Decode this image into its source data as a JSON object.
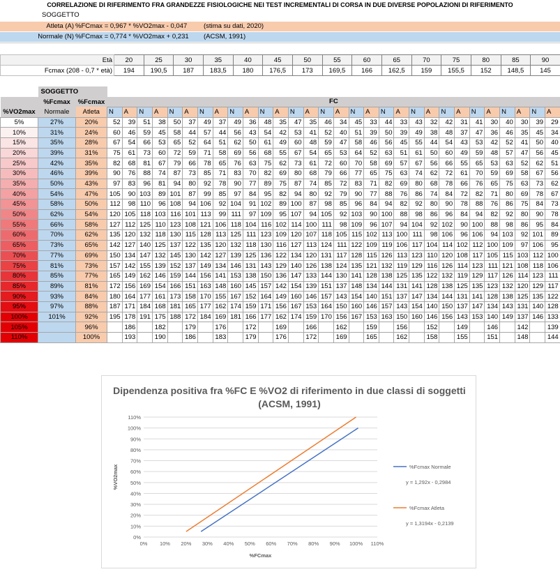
{
  "header": {
    "title": "CORRELAZIONE DI RIFERIMENTO FRA GRANDEZZE FISIOLOGICHE NEI TEST INCREMENTALI DI CORSA IN DUE DIVERSE POPOLAZIONI DI RIFERIMENTO",
    "soggetto": "SOGGETTO",
    "atleta": {
      "label": "Atleta (A)",
      "equation": "%FCmax = 0,967 * %VO2max - 0,047",
      "note": "(stima su dati, 2020)"
    },
    "normale": {
      "label": "Normale (N)",
      "equation": "%FCmax = 0,774 * %VO2max + 0,231",
      "note": "(ACSM, 1991)"
    }
  },
  "age_table": {
    "eta_label": "Età",
    "fcmax_label": "Fcmax (208 - 0,7 * età)",
    "eta": [
      "20",
      "25",
      "30",
      "35",
      "40",
      "45",
      "50",
      "55",
      "60",
      "65",
      "70",
      "75",
      "80",
      "85",
      "90"
    ],
    "fcmax": [
      "194",
      "190,5",
      "187",
      "183,5",
      "180",
      "176,5",
      "173",
      "169,5",
      "166",
      "162,5",
      "159",
      "155,5",
      "152",
      "148,5",
      "145"
    ]
  },
  "main_table": {
    "soggetto_label": "SOGGETTO",
    "fc_label": "FC",
    "vo2_header": "%VO2max",
    "fcmax_header": "%Fcmax",
    "normale_header": "Normale",
    "atleta_header": "Atleta",
    "n_label": "N",
    "a_label": "A",
    "rows": [
      {
        "vo2": "5%",
        "n": "27%",
        "a": "20%",
        "v": [
          "52",
          "39",
          "51",
          "38",
          "50",
          "37",
          "49",
          "37",
          "49",
          "36",
          "48",
          "35",
          "47",
          "35",
          "46",
          "34",
          "45",
          "33",
          "44",
          "33",
          "43",
          "32",
          "42",
          "31",
          "41",
          "30",
          "40",
          "30",
          "39",
          "29"
        ]
      },
      {
        "vo2": "10%",
        "n": "31%",
        "a": "24%",
        "v": [
          "60",
          "46",
          "59",
          "45",
          "58",
          "44",
          "57",
          "44",
          "56",
          "43",
          "54",
          "42",
          "53",
          "41",
          "52",
          "40",
          "51",
          "39",
          "50",
          "39",
          "49",
          "38",
          "48",
          "37",
          "47",
          "36",
          "46",
          "35",
          "45",
          "34"
        ]
      },
      {
        "vo2": "15%",
        "n": "35%",
        "a": "28%",
        "v": [
          "67",
          "54",
          "66",
          "53",
          "65",
          "52",
          "64",
          "51",
          "62",
          "50",
          "61",
          "49",
          "60",
          "48",
          "59",
          "47",
          "58",
          "46",
          "56",
          "45",
          "55",
          "44",
          "54",
          "43",
          "53",
          "42",
          "52",
          "41",
          "50",
          "40"
        ]
      },
      {
        "vo2": "20%",
        "n": "39%",
        "a": "31%",
        "v": [
          "75",
          "61",
          "73",
          "60",
          "72",
          "59",
          "71",
          "58",
          "69",
          "56",
          "68",
          "55",
          "67",
          "54",
          "65",
          "53",
          "64",
          "52",
          "63",
          "51",
          "61",
          "50",
          "60",
          "49",
          "59",
          "48",
          "57",
          "47",
          "56",
          "45"
        ]
      },
      {
        "vo2": "25%",
        "n": "42%",
        "a": "35%",
        "v": [
          "82",
          "68",
          "81",
          "67",
          "79",
          "66",
          "78",
          "65",
          "76",
          "63",
          "75",
          "62",
          "73",
          "61",
          "72",
          "60",
          "70",
          "58",
          "69",
          "57",
          "67",
          "56",
          "66",
          "55",
          "65",
          "53",
          "63",
          "52",
          "62",
          "51"
        ]
      },
      {
        "vo2": "30%",
        "n": "46%",
        "a": "39%",
        "v": [
          "90",
          "76",
          "88",
          "74",
          "87",
          "73",
          "85",
          "71",
          "83",
          "70",
          "82",
          "69",
          "80",
          "68",
          "79",
          "66",
          "77",
          "65",
          "75",
          "63",
          "74",
          "62",
          "72",
          "61",
          "70",
          "59",
          "69",
          "58",
          "67",
          "56"
        ]
      },
      {
        "vo2": "35%",
        "n": "50%",
        "a": "43%",
        "v": [
          "97",
          "83",
          "96",
          "81",
          "94",
          "80",
          "92",
          "78",
          "90",
          "77",
          "89",
          "75",
          "87",
          "74",
          "85",
          "72",
          "83",
          "71",
          "82",
          "69",
          "80",
          "68",
          "78",
          "66",
          "76",
          "65",
          "75",
          "63",
          "73",
          "62"
        ]
      },
      {
        "vo2": "40%",
        "n": "54%",
        "a": "47%",
        "v": [
          "105",
          "90",
          "103",
          "89",
          "101",
          "87",
          "99",
          "85",
          "97",
          "84",
          "95",
          "82",
          "94",
          "80",
          "92",
          "79",
          "90",
          "77",
          "88",
          "76",
          "86",
          "74",
          "84",
          "72",
          "82",
          "71",
          "80",
          "69",
          "78",
          "67"
        ]
      },
      {
        "vo2": "45%",
        "n": "58%",
        "a": "50%",
        "v": [
          "112",
          "98",
          "110",
          "96",
          "108",
          "94",
          "106",
          "92",
          "104",
          "91",
          "102",
          "89",
          "100",
          "87",
          "98",
          "85",
          "96",
          "84",
          "94",
          "82",
          "92",
          "80",
          "90",
          "78",
          "88",
          "76",
          "86",
          "75",
          "84",
          "73"
        ]
      },
      {
        "vo2": "50%",
        "n": "62%",
        "a": "54%",
        "v": [
          "120",
          "105",
          "118",
          "103",
          "116",
          "101",
          "113",
          "99",
          "111",
          "97",
          "109",
          "95",
          "107",
          "94",
          "105",
          "92",
          "103",
          "90",
          "100",
          "88",
          "98",
          "86",
          "96",
          "84",
          "94",
          "82",
          "92",
          "80",
          "90",
          "78"
        ]
      },
      {
        "vo2": "55%",
        "n": "66%",
        "a": "58%",
        "v": [
          "127",
          "112",
          "125",
          "110",
          "123",
          "108",
          "121",
          "106",
          "118",
          "104",
          "116",
          "102",
          "114",
          "100",
          "111",
          "98",
          "109",
          "96",
          "107",
          "94",
          "104",
          "92",
          "102",
          "90",
          "100",
          "88",
          "98",
          "86",
          "95",
          "84"
        ]
      },
      {
        "vo2": "60%",
        "n": "70%",
        "a": "62%",
        "v": [
          "135",
          "120",
          "132",
          "118",
          "130",
          "115",
          "128",
          "113",
          "125",
          "111",
          "123",
          "109",
          "120",
          "107",
          "118",
          "105",
          "115",
          "102",
          "113",
          "100",
          "111",
          "98",
          "106",
          "96",
          "106",
          "94",
          "103",
          "92",
          "101",
          "89"
        ]
      },
      {
        "vo2": "65%",
        "n": "73%",
        "a": "65%",
        "v": [
          "142",
          "127",
          "140",
          "125",
          "137",
          "122",
          "135",
          "120",
          "132",
          "118",
          "130",
          "116",
          "127",
          "113",
          "124",
          "111",
          "122",
          "109",
          "119",
          "106",
          "117",
          "104",
          "114",
          "102",
          "112",
          "100",
          "109",
          "97",
          "106",
          "95"
        ]
      },
      {
        "vo2": "70%",
        "n": "77%",
        "a": "69%",
        "v": [
          "150",
          "134",
          "147",
          "132",
          "145",
          "130",
          "142",
          "127",
          "139",
          "125",
          "136",
          "122",
          "134",
          "120",
          "131",
          "117",
          "128",
          "115",
          "126",
          "113",
          "123",
          "110",
          "120",
          "108",
          "117",
          "105",
          "115",
          "103",
          "112",
          "100"
        ]
      },
      {
        "vo2": "75%",
        "n": "81%",
        "a": "73%",
        "v": [
          "157",
          "142",
          "155",
          "139",
          "152",
          "137",
          "149",
          "134",
          "146",
          "131",
          "143",
          "129",
          "140",
          "126",
          "138",
          "124",
          "135",
          "121",
          "132",
          "119",
          "129",
          "116",
          "126",
          "114",
          "123",
          "111",
          "121",
          "108",
          "118",
          "106"
        ]
      },
      {
        "vo2": "80%",
        "n": "85%",
        "a": "77%",
        "v": [
          "165",
          "149",
          "162",
          "146",
          "159",
          "144",
          "156",
          "141",
          "153",
          "138",
          "150",
          "136",
          "147",
          "133",
          "144",
          "130",
          "141",
          "128",
          "138",
          "125",
          "135",
          "122",
          "132",
          "119",
          "129",
          "117",
          "126",
          "114",
          "123",
          "111"
        ]
      },
      {
        "vo2": "85%",
        "n": "89%",
        "a": "81%",
        "v": [
          "172",
          "156",
          "169",
          "154",
          "166",
          "151",
          "163",
          "148",
          "160",
          "145",
          "157",
          "142",
          "154",
          "139",
          "151",
          "137",
          "148",
          "134",
          "144",
          "131",
          "141",
          "128",
          "138",
          "125",
          "135",
          "123",
          "132",
          "120",
          "129",
          "117"
        ]
      },
      {
        "vo2": "90%",
        "n": "93%",
        "a": "84%",
        "v": [
          "180",
          "164",
          "177",
          "161",
          "173",
          "158",
          "170",
          "155",
          "167",
          "152",
          "164",
          "149",
          "160",
          "146",
          "157",
          "143",
          "154",
          "140",
          "151",
          "137",
          "147",
          "134",
          "144",
          "131",
          "141",
          "128",
          "138",
          "125",
          "135",
          "122"
        ]
      },
      {
        "vo2": "95%",
        "n": "97%",
        "a": "88%",
        "v": [
          "187",
          "171",
          "184",
          "168",
          "181",
          "165",
          "177",
          "162",
          "174",
          "159",
          "171",
          "156",
          "167",
          "153",
          "164",
          "150",
          "160",
          "146",
          "157",
          "143",
          "154",
          "140",
          "150",
          "137",
          "147",
          "134",
          "143",
          "131",
          "140",
          "128"
        ]
      },
      {
        "vo2": "100%",
        "n": "101%",
        "a": "92%",
        "v": [
          "195",
          "178",
          "191",
          "175",
          "188",
          "172",
          "184",
          "169",
          "181",
          "166",
          "177",
          "162",
          "174",
          "159",
          "170",
          "156",
          "167",
          "153",
          "163",
          "150",
          "160",
          "146",
          "156",
          "143",
          "153",
          "140",
          "149",
          "137",
          "146",
          "133"
        ]
      },
      {
        "vo2": "105%",
        "n": "",
        "a": "96%",
        "v": [
          "",
          "186",
          "",
          "182",
          "",
          "179",
          "",
          "176",
          "",
          "172",
          "",
          "169",
          "",
          "166",
          "",
          "162",
          "",
          "159",
          "",
          "156",
          "",
          "152",
          "",
          "149",
          "",
          "146",
          "",
          "142",
          "",
          "139"
        ]
      },
      {
        "vo2": "110%",
        "n": "",
        "a": "100%",
        "v": [
          "",
          "193",
          "",
          "190",
          "",
          "186",
          "",
          "183",
          "",
          "179",
          "",
          "176",
          "",
          "172",
          "",
          "169",
          "",
          "165",
          "",
          "162",
          "",
          "158",
          "",
          "155",
          "",
          "151",
          "",
          "148",
          "",
          "144"
        ]
      }
    ]
  },
  "row_colors": [
    "#ffffff",
    "#fcf1f1",
    "#fbe4e4",
    "#f9d6d7",
    "#f8c9ca",
    "#f6bcbd",
    "#f5aeaf",
    "#f3a1a2",
    "#f29395",
    "#f08688",
    "#ef797b",
    "#ed6b6e",
    "#ec5e61",
    "#ea5053",
    "#e94346",
    "#e73539",
    "#e6282c",
    "#e41b1f",
    "#e30d12",
    "#e20005",
    "#e20005",
    "#e20005"
  ],
  "chart_data": {
    "type": "line",
    "title": "Dipendenza positiva fra %FC E %VO2 di riferimento in due classi di soggetti (ACSM, 1991)",
    "xlabel": "%FCmax",
    "ylabel": "%VO2max",
    "xlim": [
      0,
      1.1
    ],
    "ylim": [
      0,
      1.1
    ],
    "xticks": [
      "0%",
      "10%",
      "20%",
      "30%",
      "40%",
      "50%",
      "60%",
      "70%",
      "80%",
      "90%",
      "100%",
      "110%"
    ],
    "yticks": [
      "0%",
      "10%",
      "20%",
      "30%",
      "40%",
      "50%",
      "60%",
      "70%",
      "80%",
      "90%",
      "100%",
      "110%"
    ],
    "series": [
      {
        "name": "%Fcmax Normale",
        "color": "#4472c4",
        "equation": "y = 1,292x - 0,2984",
        "x": [
          0.27,
          1.01
        ],
        "y": [
          0.05,
          1.0
        ]
      },
      {
        "name": "%Fcmax Atleta",
        "color": "#ed7d31",
        "equation": "y = 1,3194x - 0,2139",
        "x": [
          0.2,
          1.0
        ],
        "y": [
          0.05,
          1.1
        ]
      }
    ],
    "legend_position": "right"
  }
}
